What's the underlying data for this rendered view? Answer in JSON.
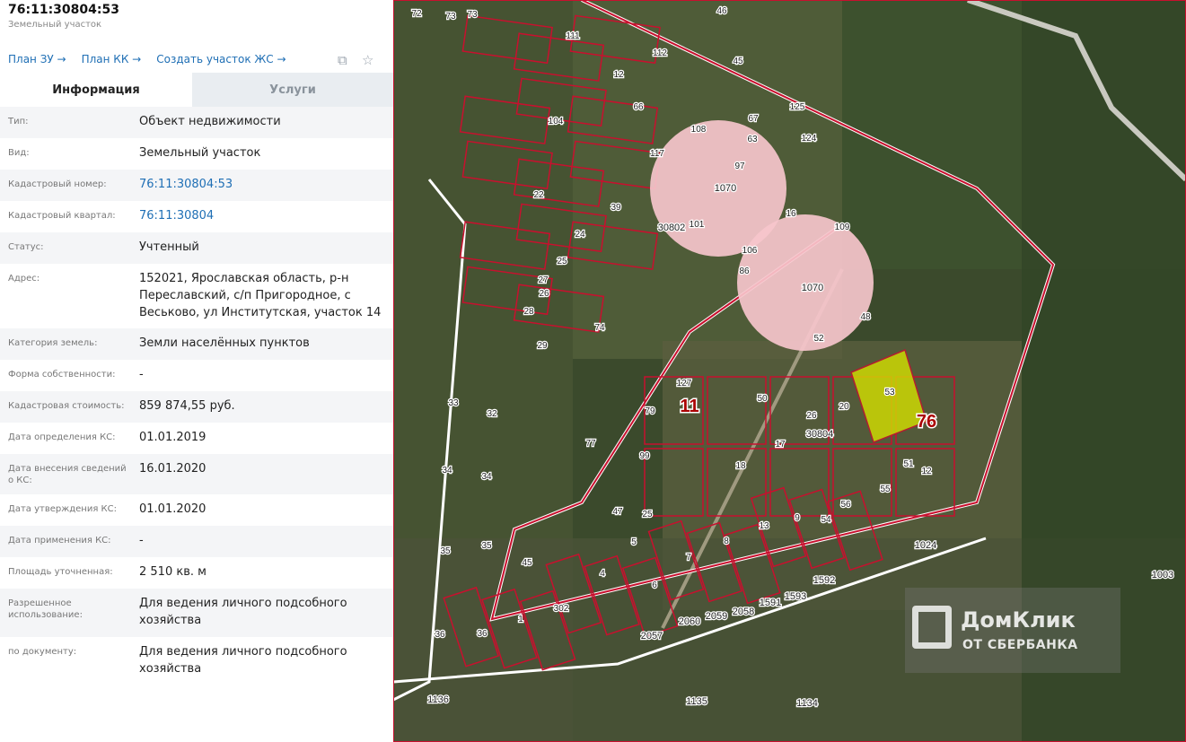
{
  "header": {
    "title": "76:11:30804:53",
    "subtitle": "Земельный участок"
  },
  "links": [
    "План ЗУ →",
    "План КК →",
    "Создать участок ЖС →"
  ],
  "icons": {
    "preview": "document-search-icon",
    "favorite": "star-icon"
  },
  "tabs": [
    {
      "label": "Информация",
      "active": true
    },
    {
      "label": "Услуги",
      "active": false
    }
  ],
  "rows": [
    {
      "label": "Тип:",
      "value": "Объект недвижимости"
    },
    {
      "label": "Вид:",
      "value": "Земельный участок"
    },
    {
      "label": "Кадастровый номер:",
      "value": "76:11:30804:53",
      "link": true
    },
    {
      "label": "Кадастровый квартал:",
      "value": "76:11:30804",
      "link": true
    },
    {
      "label": "Статус:",
      "value": "Учтенный"
    },
    {
      "label": "Адрес:",
      "value": "152021, Ярославская область, р-н Переславский, с/п Пригородное, с Веськово, ул Институтская, участок 14"
    },
    {
      "label": "Категория земель:",
      "value": "Земли населённых пунктов"
    },
    {
      "label": "Форма собственности:",
      "value": "-"
    },
    {
      "label": "Кадастровая стоимость:",
      "value": "859 874,55 руб."
    },
    {
      "label": "Дата определения КС:",
      "value": "01.01.2019"
    },
    {
      "label": "Дата внесения сведений о КС:",
      "value": "16.01.2020"
    },
    {
      "label": "Дата утверждения КС:",
      "value": "01.01.2020"
    },
    {
      "label": "Дата применения КС:",
      "value": "-"
    },
    {
      "label": "Площадь уточненная:",
      "value": "2 510 кв. м"
    },
    {
      "label": "Разрешенное использование:",
      "value": "Для ведения личного подсобного хозяйства"
    },
    {
      "label": "по документу:",
      "value": "Для ведения личного подсобного хозяйства"
    }
  ],
  "map": {
    "labels": [
      "72",
      "73",
      "73",
      "46",
      "111",
      "112",
      "45",
      "12",
      "125",
      "66",
      "104",
      "108",
      "63",
      "67",
      "124",
      "117",
      "97",
      "1070",
      "22",
      "39",
      "101",
      "30802",
      "16",
      "109",
      "24",
      "106",
      "25",
      "86",
      "1070",
      "27",
      "26",
      "48",
      "28",
      "52",
      "74",
      "29",
      "53",
      "76",
      "127",
      "33",
      "32",
      "79",
      "11",
      "50",
      "26",
      "30804",
      "20",
      "77",
      "99",
      "17",
      "18",
      "34",
      "34",
      "51",
      "12",
      "55",
      "56",
      "54",
      "9",
      "13",
      "8",
      "7",
      "25",
      "47",
      "5",
      "35",
      "35",
      "45",
      "4",
      "6",
      "302",
      "1",
      "36",
      "36",
      "2057",
      "2060",
      "2059",
      "2058",
      "1591",
      "1593",
      "1592",
      "1024",
      "1003",
      "1136",
      "1135",
      "1134"
    ],
    "selected_parcel": "53",
    "watermark": {
      "name": "ДомКлик",
      "sub": "ОТ СБЕРБАНКА"
    },
    "colors": {
      "parcel_border": "#c8102e",
      "selected_fill": "#d4e000",
      "circle_fill": "#f6c6cc"
    }
  }
}
